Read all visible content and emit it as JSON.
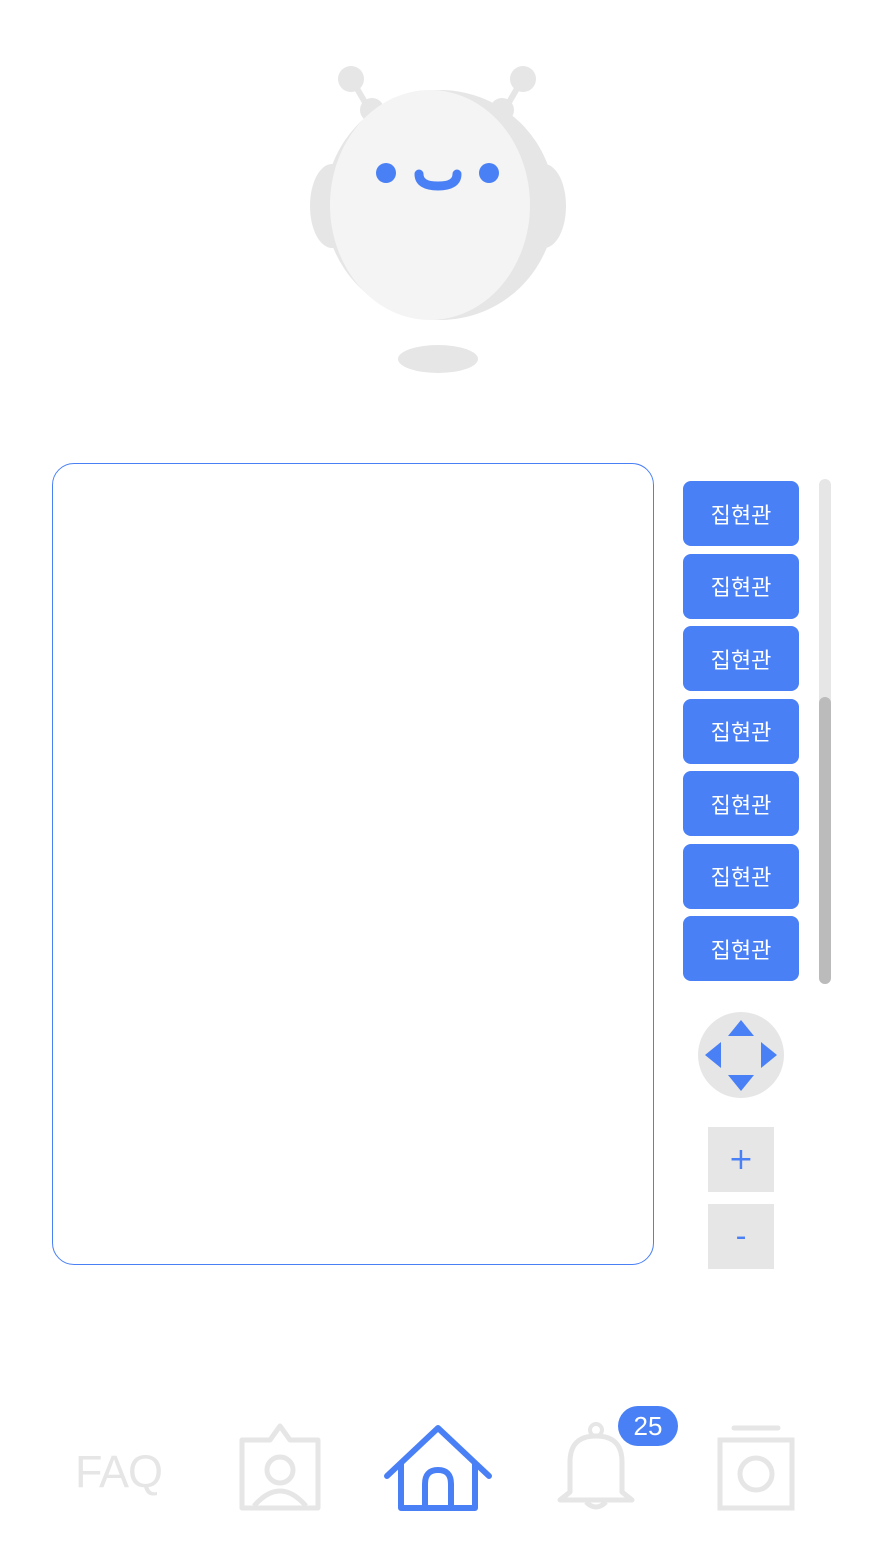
{
  "buildings": [
    "집현관",
    "집현관",
    "집현관",
    "집현관",
    "집현관",
    "집현관",
    "집현관"
  ],
  "zoom": {
    "in_label": "+",
    "out_label": "-"
  },
  "nav": {
    "faq_label": "FAQ",
    "notification_count": "25",
    "active_tab": "home"
  },
  "colors": {
    "accent": "#4a80f5",
    "inactive": "#e6e6e6",
    "robot_body": "#f4f4f4",
    "robot_shade": "#e6e6e6"
  },
  "icons": {
    "robot": "robot-mascot-icon",
    "profile": "profile-card-icon",
    "home": "home-icon",
    "bell": "bell-icon",
    "camera": "camera-icon"
  }
}
